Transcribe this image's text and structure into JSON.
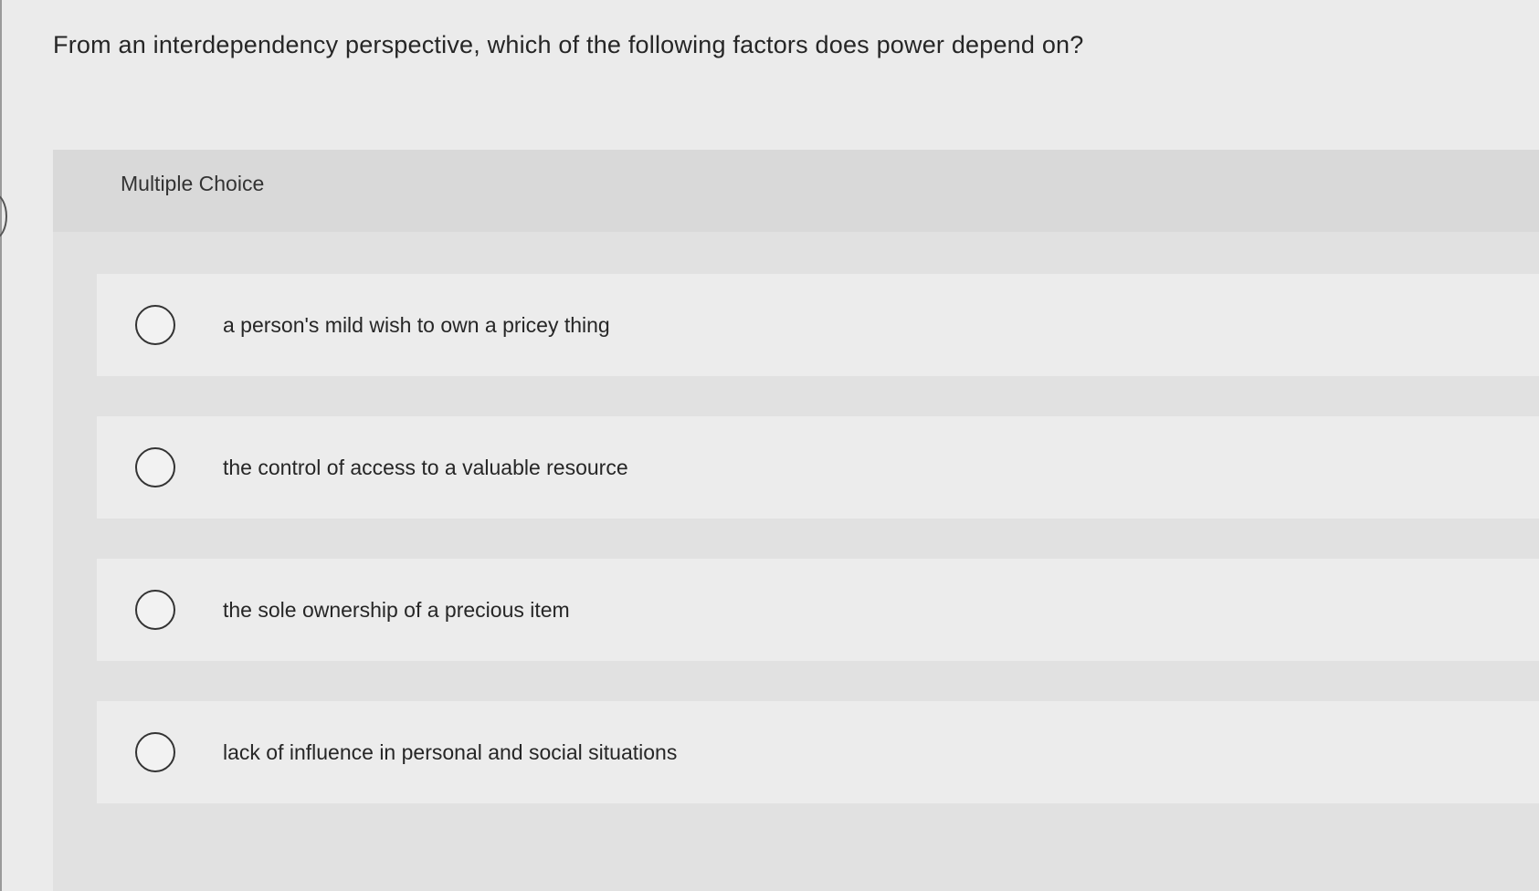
{
  "question": {
    "text": "From an interdependency perspective, which of the following factors does power depend on?"
  },
  "panel": {
    "label": "Multiple Choice"
  },
  "choices": [
    {
      "label": "a person's mild wish to own a pricey thing",
      "selected": false
    },
    {
      "label": "the control of access to a valuable resource",
      "selected": false
    },
    {
      "label": "the sole ownership of a precious item",
      "selected": false
    },
    {
      "label": "lack of influence in personal and social situations",
      "selected": false
    }
  ]
}
